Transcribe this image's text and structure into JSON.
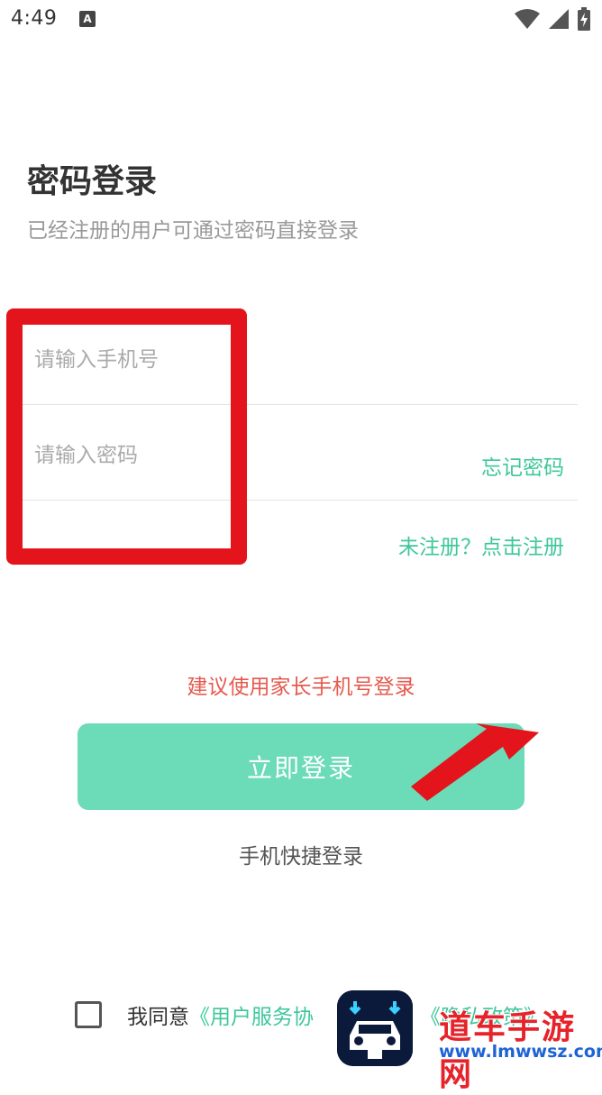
{
  "status_bar": {
    "time": "4:49",
    "notification_glyph": "A",
    "icons": [
      "wifi-icon",
      "cellular-signal-icon",
      "battery-charging-icon"
    ]
  },
  "header": {
    "title": "密码登录",
    "subtitle": "已经注册的用户可通过密码直接登录"
  },
  "form": {
    "phone_placeholder": "请输入手机号",
    "password_placeholder": "请输入密码",
    "forgot_password": "忘记密码",
    "register_link": "未注册？点击注册"
  },
  "hint": "建议使用家长手机号登录",
  "login_button": "立即登录",
  "quick_login": "手机快捷登录",
  "agreement": {
    "prefix": "我同意",
    "user_agreement": "《用户服务协",
    "privacy_policy": "《隐私政策》"
  },
  "watermark": {
    "site_name": "道车手游网",
    "url": "www.lmwwsz.com"
  },
  "colors": {
    "accent_green": "#3ec79b",
    "button_green": "#6cdbb7",
    "hint_red": "#e55a4e",
    "annotation_red": "#e3141b"
  }
}
